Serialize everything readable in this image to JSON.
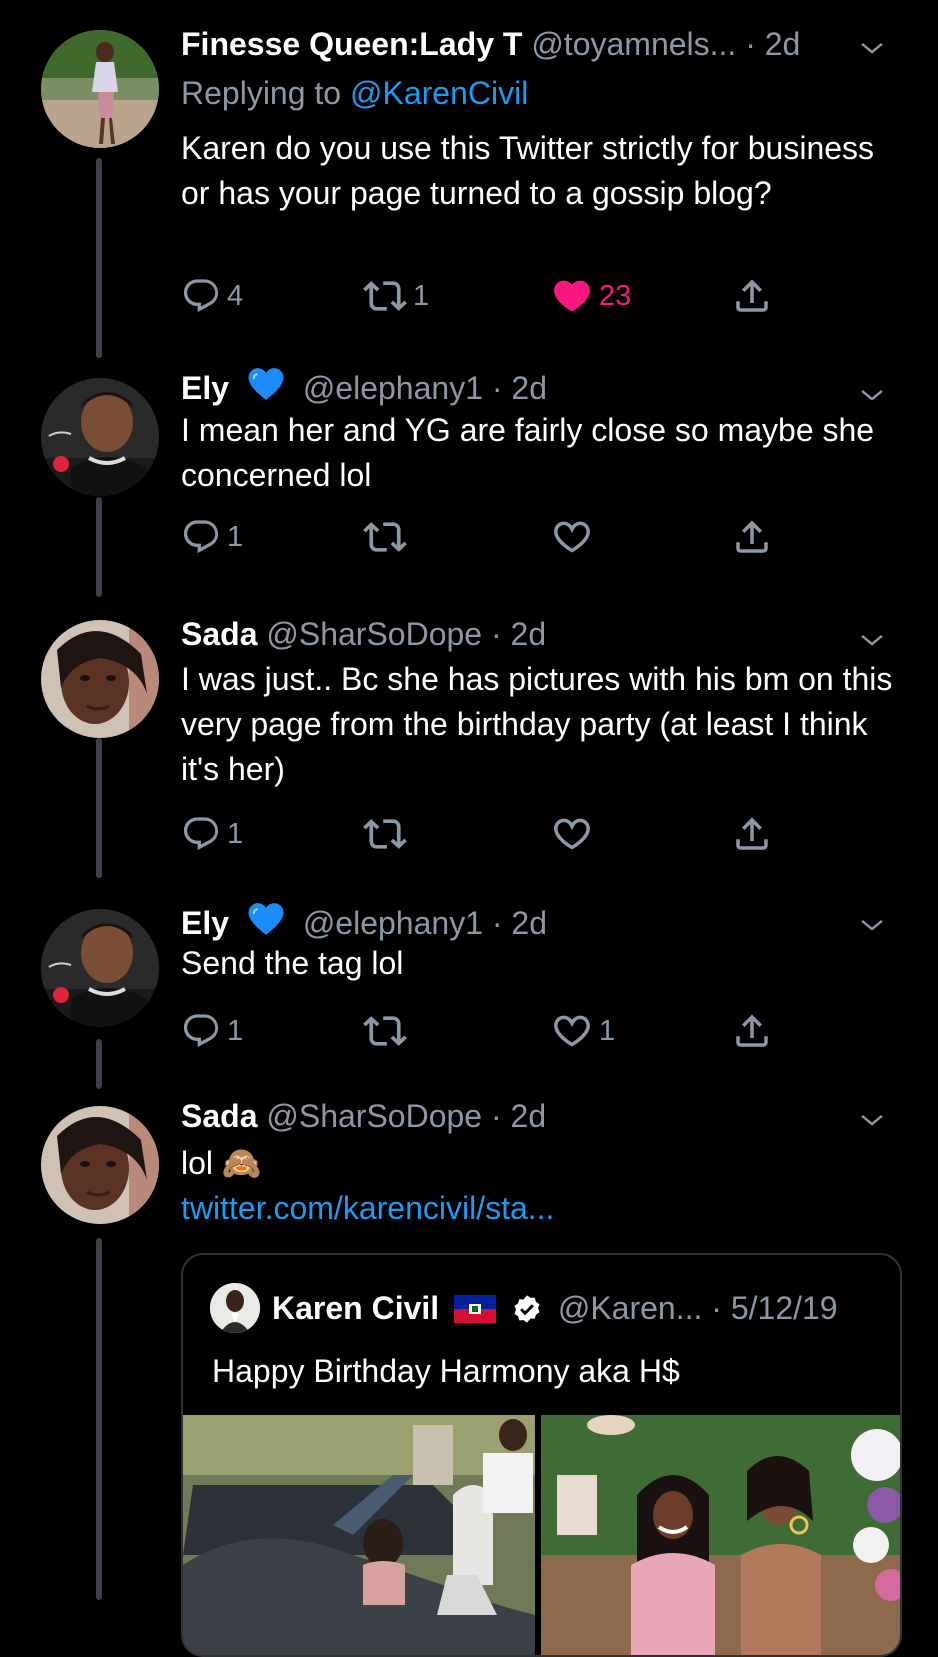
{
  "tweets": [
    {
      "name": "Finesse Queen:Lady T",
      "handle": "@toyamnels...",
      "dot": "·",
      "time": "2d",
      "replying_prefix": "Replying to",
      "replying_to": "@KarenCivil",
      "text": "Karen do you use this Twitter strictly for business or has your page turned to a gossip blog?",
      "reply_count": "4",
      "retweet_count": "1",
      "like_count": "23"
    },
    {
      "name": "Ely",
      "badge": "blue-heart-emoji",
      "handle": "@elephany1",
      "dot": "·",
      "time": "2d",
      "text": "I mean her and YG are fairly close so maybe she concerned lol",
      "reply_count": "1",
      "retweet_count": "",
      "like_count": ""
    },
    {
      "name": "Sada",
      "handle": "@SharSoDope",
      "dot": "·",
      "time": "2d",
      "text": "I was just.. Bc she has pictures with his bm on this very page from the birthday party (at least I think it's her)",
      "reply_count": "1",
      "retweet_count": "",
      "like_count": ""
    },
    {
      "name": "Ely",
      "badge": "blue-heart-emoji",
      "handle": "@elephany1",
      "dot": "·",
      "time": "2d",
      "text": "Send the tag lol",
      "reply_count": "1",
      "retweet_count": "",
      "like_count": "1"
    },
    {
      "name": "Sada",
      "handle": "@SharSoDope",
      "dot": "·",
      "time": "2d",
      "text": "lol 🙈",
      "link": "twitter.com/karencivil/sta...",
      "reply_count": "",
      "retweet_count": "",
      "like_count": ""
    }
  ],
  "quote": {
    "name": "Karen Civil",
    "flag": "haiti-flag",
    "verified": "verified-badge-icon",
    "handle": "@Karen...",
    "dot": "·",
    "date": "5/12/19",
    "text": "Happy Birthday Harmony aka H$"
  },
  "colors": {
    "background": "#000000",
    "text": "#ffffff",
    "secondary": "#8b98a5",
    "link": "#1d9bf0",
    "like": "#f91880",
    "thread_line": "#3d4249"
  },
  "icons": [
    "reply-icon",
    "retweet-icon",
    "like-icon",
    "share-icon",
    "chevron-down-icon"
  ]
}
